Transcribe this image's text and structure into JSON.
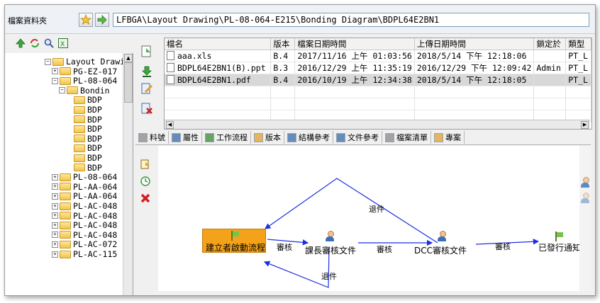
{
  "address_bar": {
    "label": "檔案資料夾",
    "path": "LFBGA\\Layout Drawing\\PL-08-064-E215\\Bonding Diagram\\BDPL64E2BN1"
  },
  "tree": {
    "items": [
      {
        "label": "Layout Drawi",
        "expander": "−",
        "indent": 0
      },
      {
        "label": "PG-EZ-017",
        "expander": "+",
        "indent": 1
      },
      {
        "label": "PL-08-064",
        "expander": "−",
        "indent": 1
      },
      {
        "label": "Bondin",
        "expander": "−",
        "indent": 2
      },
      {
        "label": "BDP",
        "expander": "",
        "indent": 3
      },
      {
        "label": "BDP",
        "expander": "",
        "indent": 3
      },
      {
        "label": "BDP",
        "expander": "",
        "indent": 3
      },
      {
        "label": "BDP",
        "expander": "",
        "indent": 3
      },
      {
        "label": "BDP",
        "expander": "",
        "indent": 3
      },
      {
        "label": "BDP",
        "expander": "",
        "indent": 3
      },
      {
        "label": "BDP",
        "expander": "",
        "indent": 3
      },
      {
        "label": "BDP",
        "expander": "",
        "indent": 3
      },
      {
        "label": "PL-08-064",
        "expander": "+",
        "indent": 1
      },
      {
        "label": "PL-AA-064",
        "expander": "+",
        "indent": 1
      },
      {
        "label": "PL-AA-064",
        "expander": "+",
        "indent": 1
      },
      {
        "label": "PL-AC-048",
        "expander": "+",
        "indent": 1
      },
      {
        "label": "PL-AC-048",
        "expander": "+",
        "indent": 1
      },
      {
        "label": "PL-AC-048",
        "expander": "+",
        "indent": 1
      },
      {
        "label": "PL-AC-048",
        "expander": "+",
        "indent": 1
      },
      {
        "label": "PL-AC-072",
        "expander": "+",
        "indent": 1
      },
      {
        "label": "PL-AC-115",
        "expander": "+",
        "indent": 1
      }
    ]
  },
  "file_table": {
    "columns": [
      "檔名",
      "版本",
      "檔案日期時間",
      "上傳日期時間",
      "鎖定於",
      "類型"
    ],
    "rows": [
      {
        "name": "aaa.xls",
        "version": "B.4",
        "file_date": "2017/11/16 上午 01:03:56",
        "upload_date": "2018/5/14 下午 12:18:06",
        "locked_by": "",
        "type": "PT_L"
      },
      {
        "name": "BDPL64E2BN1(B).ppt",
        "version": "B.3",
        "file_date": "2016/12/29 上午 11:35:19",
        "upload_date": "2016/12/29 下午 12:09:42",
        "locked_by": "Admin",
        "type": "PT_L"
      },
      {
        "name": "BDPL64E2BN1.pdf",
        "version": "B.4",
        "file_date": "2016/10/19 上午 12:34:38",
        "upload_date": "2018/5/14 下午 12:18:05",
        "locked_by": "",
        "type": "PT_L"
      }
    ],
    "selected_row": 2
  },
  "tabs": [
    {
      "label": "料號",
      "color": "#8a8a8a"
    },
    {
      "label": "屬性",
      "color": "#3a6aa8"
    },
    {
      "label": "工作流程",
      "color": "#3a8a3a"
    },
    {
      "label": "版本",
      "color": "#e0a030"
    },
    {
      "label": "結構參考",
      "color": "#3a6aa8"
    },
    {
      "label": "文件參考",
      "color": "#3a6aa8"
    },
    {
      "label": "檔案清單",
      "color": "#8a8a8a"
    },
    {
      "label": "專案",
      "color": "#e0a030"
    }
  ],
  "workflow": {
    "nodes": {
      "start": "建立者啟動流程",
      "section_review": "課長審核文件",
      "dcc_review": "DCC審核文件",
      "done": "已發行通知"
    },
    "edges": {
      "review1": "審核",
      "review2": "審核",
      "review3": "審核",
      "reject_top": "退件",
      "reject_bottom": "退件"
    },
    "start_node_color": "#f5a21b",
    "edge_color": "#1f2fe0"
  }
}
